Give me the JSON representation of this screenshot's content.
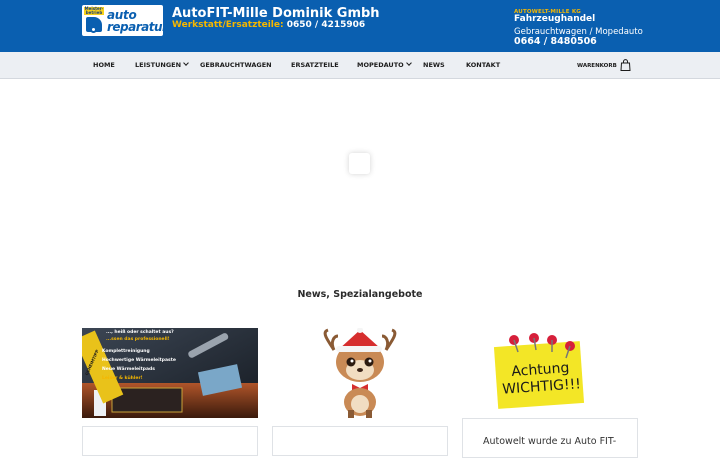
{
  "header": {
    "logo": {
      "badge": "Meister-betrieb",
      "line1": "auto",
      "line2": "reparatur"
    },
    "company_name": "AutoFIT-Mille Dominik Gmbh",
    "workshop_label": "Werkstatt/Ersatzteile:",
    "workshop_phone": "0650 / 4215906",
    "right": {
      "company": "AUTOWELT-MILLE KG",
      "headline": "Fahrzeughandel",
      "sub": "Gebrauchtwagen / Mopedauto",
      "phone": "0664 / 8480506"
    },
    "colors": {
      "bar": "#0a5fb0",
      "accent": "#f5b700"
    }
  },
  "nav": {
    "items": [
      {
        "label": "HOME",
        "dropdown": false
      },
      {
        "label": "LEISTUNGEN",
        "dropdown": true
      },
      {
        "label": "GEBRAUCHTWAGEN",
        "dropdown": false
      },
      {
        "label": "ERSATZTEILE",
        "dropdown": false
      },
      {
        "label": "MOPEDAUTO",
        "dropdown": true
      },
      {
        "label": "NEWS",
        "dropdown": false
      },
      {
        "label": "KONTAKT",
        "dropdown": false
      }
    ],
    "cart_label": "WARENKORB"
  },
  "main": {
    "section_title": "News, Spezialangebote",
    "cards": [
      {
        "image": "pc-cleaning-promo",
        "image_lines": [
          "..., heiß oder schaltet aus?",
          "...ssen das professionell!",
          "Komplettreinigung",
          "Hochwertige Wärmeleitpaste",
          "Neue Wärmeleitpads",
          "Leiser & kühler!"
        ],
        "image_ribbon": "GEHEIMTIPP"
      },
      {
        "image": "christmas-reindeer"
      },
      {
        "image": "achtung-wichtig-note",
        "image_note": "Achtung WICHTIG!!!",
        "text": "Autowelt wurde zu Auto FIT-"
      }
    ]
  }
}
